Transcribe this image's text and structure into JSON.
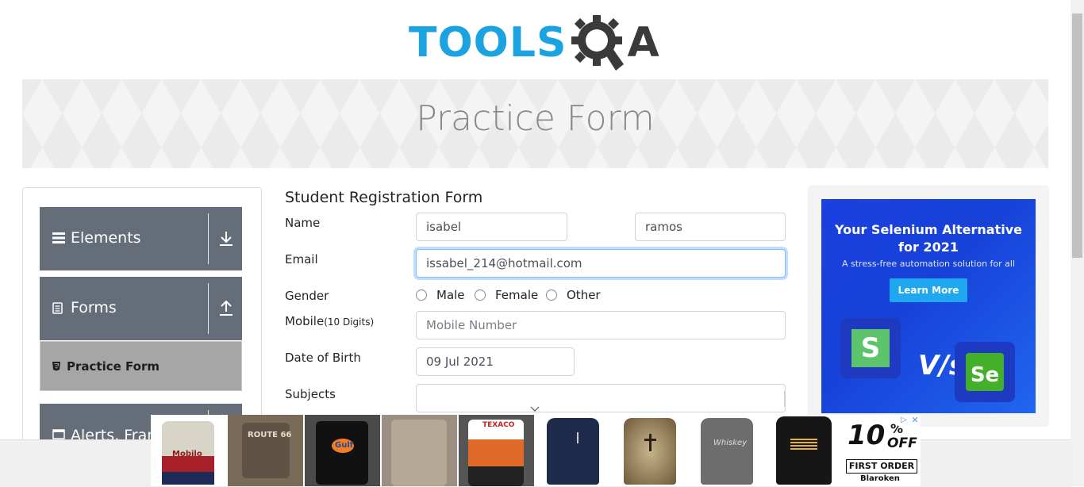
{
  "logo": {
    "tools": "TOOLS",
    "a": "A"
  },
  "banner": {
    "title": "Practice Form"
  },
  "sidebar": {
    "groups": [
      {
        "label": "Elements",
        "icon": "list-icon",
        "arrow": "download-arrow-icon"
      },
      {
        "label": "Forms",
        "icon": "document-icon",
        "arrow": "upload-arrow-icon"
      },
      {
        "label": "Alerts, Frame",
        "icon": "window-icon"
      }
    ],
    "active_item": {
      "label": "Practice Form",
      "icon": "html5-icon"
    }
  },
  "form": {
    "title": "Student Registration Form",
    "name_label": "Name",
    "first_name": "isabel",
    "last_name": "ramos",
    "email_label": "Email",
    "email": "issabel_214@hotmail.com",
    "gender_label": "Gender",
    "gender_options": [
      "Male",
      "Female",
      "Other"
    ],
    "mobile_label": "Mobile",
    "mobile_hint": "(10 Digits)",
    "mobile_placeholder": "Mobile Number",
    "dob_label": "Date of Birth",
    "dob": "09 Jul 2021",
    "subjects_label": "Subjects"
  },
  "right_ad": {
    "headline_1": "Your Selenium Alternative",
    "headline_2": "for 2021",
    "subline": "A stress-free automation solution for all",
    "button": "Learn More",
    "vs": "V/s",
    "logo_left": "S",
    "logo_right": "Se"
  },
  "bottom_ad": {
    "promo_1": "10",
    "promo_pct": "%",
    "promo_off": "OFF",
    "promo_2": "FIRST ORDER",
    "promo_brand": "Blaroken",
    "shirt_texts": [
      "Mobilo",
      "ROUTE 66",
      "Gulf",
      "",
      "TEXACO",
      "",
      "",
      "Whiskey",
      "",
      ""
    ]
  },
  "colors": {
    "logo_blue": "#1aa3e0",
    "logo_dark": "#3a3a3a",
    "sidebar_group": "#656d78",
    "sidebar_active": "#a6a6a6",
    "focus_border": "#80bdff",
    "ad_blue": "#1b3fe0"
  }
}
